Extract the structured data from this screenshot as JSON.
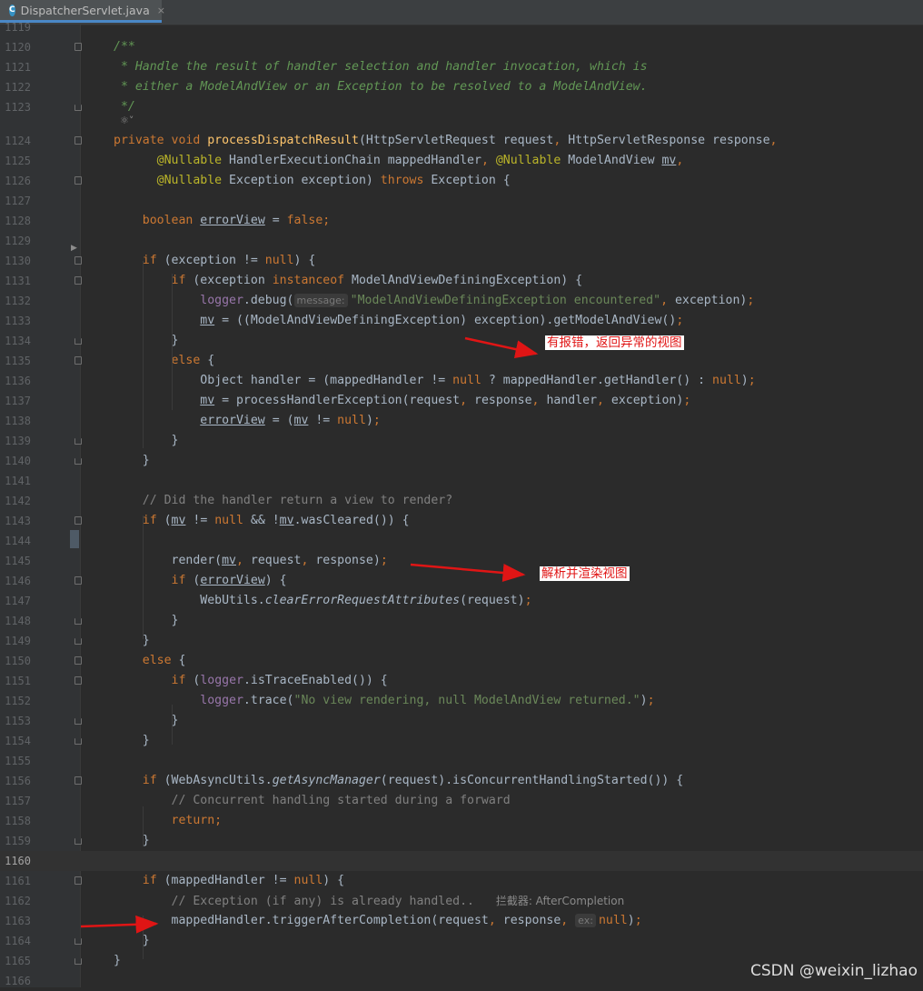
{
  "tab": {
    "label": "DispatcherServlet.java",
    "icon": "class-c-icon",
    "close": "×"
  },
  "lines": [
    {
      "n": "1119",
      "html": ""
    },
    {
      "n": "1120",
      "html": "<span class=\"jd\">/**</span>"
    },
    {
      "n": "1121",
      "html": "<span class=\"jd\"> * Handle the result of handler selection and handler invocation, which is</span>"
    },
    {
      "n": "1122",
      "html": "<span class=\"jd\"> * either a ModelAndView or an Exception to be resolved to a ModelAndView.</span>"
    },
    {
      "n": "1123",
      "html": "<span class=\"jd\"> */</span>"
    },
    {
      "n": "1124",
      "html": "<span class=\"k\">private void </span><span class=\"m\">processDispatchResult</span>(HttpServletRequest request<span class=\"k\">, </span>HttpServletResponse response<span class=\"k\">,</span>"
    },
    {
      "n": "1125",
      "html": "      <span class=\"a\">@Nullable</span> HandlerExecutionChain mappedHandler<span class=\"k\">, </span><span class=\"a\">@Nullable</span> ModelAndView <span class=\"u\">mv</span><span class=\"k\">,</span>"
    },
    {
      "n": "1126",
      "html": "      <span class=\"a\">@Nullable</span> Exception exception) <span class=\"k\">throws </span>Exception {"
    },
    {
      "n": "1127",
      "html": ""
    },
    {
      "n": "1128",
      "html": "    <span class=\"k\">boolean </span><span class=\"u\">errorView</span> = <span class=\"k\">false;</span>"
    },
    {
      "n": "1129",
      "html": ""
    },
    {
      "n": "1130",
      "html": "    <span class=\"k\">if </span>(exception != <span class=\"k\">null</span>) {"
    },
    {
      "n": "1131",
      "html": "        <span class=\"k\">if </span>(exception <span class=\"k\">instanceof </span>ModelAndViewDefiningException) {"
    },
    {
      "n": "1132",
      "html": "            <span class=\"f\">logger</span>.debug(<span class=\"hint\">message:</span><span class=\"s\">\"ModelAndViewDefiningException encountered\"</span><span class=\"k\">, </span>exception)<span class=\"k\">;</span>"
    },
    {
      "n": "1133",
      "html": "            <span class=\"u\">mv</span> = ((ModelAndViewDefiningException) exception).getModelAndView()<span class=\"k\">;</span>"
    },
    {
      "n": "1134",
      "html": "        }"
    },
    {
      "n": "1135",
      "html": "        <span class=\"k\">else </span>{"
    },
    {
      "n": "1136",
      "html": "            Object handler = (mappedHandler != <span class=\"k\">null </span>? mappedHandler.getHandler() : <span class=\"k\">null</span>)<span class=\"k\">;</span>"
    },
    {
      "n": "1137",
      "html": "            <span class=\"u\">mv</span> = processHandlerException(request<span class=\"k\">, </span>response<span class=\"k\">, </span>handler<span class=\"k\">, </span>exception)<span class=\"k\">;</span>"
    },
    {
      "n": "1138",
      "html": "            <span class=\"u\">errorView</span> = (<span class=\"u\">mv</span> != <span class=\"k\">null</span>)<span class=\"k\">;</span>"
    },
    {
      "n": "1139",
      "html": "        }"
    },
    {
      "n": "1140",
      "html": "    }"
    },
    {
      "n": "1141",
      "html": ""
    },
    {
      "n": "1142",
      "html": "    <span class=\"c\">// Did the handler return a view to render?</span>"
    },
    {
      "n": "1143",
      "html": "    <span class=\"k\">if </span>(<span class=\"u\">mv</span> != <span class=\"k\">null </span>&amp;&amp; !<span class=\"u\">mv</span>.wasCleared()) {"
    },
    {
      "n": "1144",
      "html": ""
    },
    {
      "n": "1145",
      "html": "        render(<span class=\"u\">mv</span><span class=\"k\">, </span>request<span class=\"k\">, </span>response)<span class=\"k\">;</span>"
    },
    {
      "n": "1146",
      "html": "        <span class=\"k\">if </span>(<span class=\"u\">errorView</span>) {"
    },
    {
      "n": "1147",
      "html": "            WebUtils.<span class=\"st\">clearErrorRequestAttributes</span>(request)<span class=\"k\">;</span>"
    },
    {
      "n": "1148",
      "html": "        }"
    },
    {
      "n": "1149",
      "html": "    }"
    },
    {
      "n": "1150",
      "html": "    <span class=\"k\">else </span>{"
    },
    {
      "n": "1151",
      "html": "        <span class=\"k\">if </span>(<span class=\"f\">logger</span>.isTraceEnabled()) {"
    },
    {
      "n": "1152",
      "html": "            <span class=\"f\">logger</span>.trace(<span class=\"s\">\"No view rendering, null ModelAndView returned.\"</span>)<span class=\"k\">;</span>"
    },
    {
      "n": "1153",
      "html": "        }"
    },
    {
      "n": "1154",
      "html": "    }"
    },
    {
      "n": "1155",
      "html": ""
    },
    {
      "n": "1156",
      "html": "    <span class=\"k\">if </span>(WebAsyncUtils.<span class=\"st\">getAsyncManager</span>(request).isConcurrentHandlingStarted()) {"
    },
    {
      "n": "1157",
      "html": "        <span class=\"c\">// Concurrent handling started during a forward</span>"
    },
    {
      "n": "1158",
      "html": "        <span class=\"k\">return;</span>"
    },
    {
      "n": "1159",
      "html": "    }"
    },
    {
      "n": "1160",
      "html": ""
    },
    {
      "n": "1161",
      "html": "    <span class=\"k\">if </span>(mappedHandler != <span class=\"k\">null</span>) {"
    },
    {
      "n": "1162",
      "html": "        <span class=\"c\">// Exception (if any) is already handled..   </span><span class=\"inline-note\">拦截器: AfterCompletion</span>"
    },
    {
      "n": "1163",
      "html": "        mappedHandler.triggerAfterCompletion(request<span class=\"k\">, </span>response<span class=\"k\">, </span><span class=\"hint\">ex:</span><span class=\"k\">null</span>)<span class=\"k\">;</span>"
    },
    {
      "n": "1164",
      "html": "    }"
    },
    {
      "n": "1165",
      "html": "}"
    },
    {
      "n": "1166",
      "html": ""
    }
  ],
  "annotations": {
    "error_view": "有报错，返回异常的视图",
    "render_view": "解析并渲染视图"
  },
  "watermark": "CSDN @weixin_lizhao",
  "colors": {
    "background": "#2b2b2b",
    "keyword": "#cc7832",
    "method": "#ffc66d",
    "arrow": "#e01515"
  }
}
